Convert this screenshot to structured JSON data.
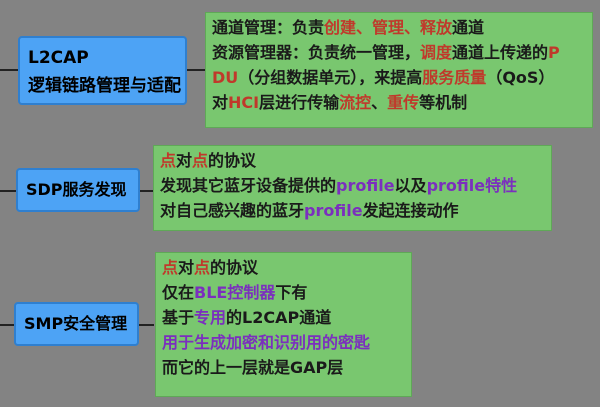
{
  "nodes": {
    "l2cap": {
      "lines": [
        "L2CAP",
        "逻辑链路管理与适配"
      ]
    },
    "sdp": {
      "label": "SDP服务发现"
    },
    "smp": {
      "label": "SMP安全管理"
    }
  },
  "panels": {
    "l2cap": {
      "rows": [
        [
          {
            "t": "通道管理：负责",
            "c": ""
          },
          {
            "t": "创建、管理、释放",
            "c": "r"
          },
          {
            "t": "通道",
            "c": ""
          }
        ],
        [
          {
            "t": "资源管理器：负责统一管理，",
            "c": ""
          },
          {
            "t": "调度",
            "c": "r"
          },
          {
            "t": "通道上传递的",
            "c": ""
          },
          {
            "t": "P",
            "c": "r"
          }
        ],
        [
          {
            "t": "DU",
            "c": "r"
          },
          {
            "t": "（分组数据单元），来提高",
            "c": ""
          },
          {
            "t": "服务质量",
            "c": "r"
          },
          {
            "t": "（QoS）",
            "c": ""
          }
        ],
        [
          {
            "t": "对",
            "c": ""
          },
          {
            "t": "HCI",
            "c": "r"
          },
          {
            "t": "层进行传输",
            "c": ""
          },
          {
            "t": "流控",
            "c": "r"
          },
          {
            "t": "、",
            "c": ""
          },
          {
            "t": "重传",
            "c": "r"
          },
          {
            "t": "等机制",
            "c": ""
          }
        ]
      ]
    },
    "sdp": {
      "rows": [
        [
          {
            "t": "点",
            "c": "r"
          },
          {
            "t": "对",
            "c": ""
          },
          {
            "t": "点",
            "c": "r"
          },
          {
            "t": "的协议",
            "c": ""
          }
        ],
        [
          {
            "t": "发现其它蓝牙设备提供的",
            "c": ""
          },
          {
            "t": "profile",
            "c": "p"
          },
          {
            "t": "以及",
            "c": ""
          },
          {
            "t": "profile特性",
            "c": "p"
          }
        ],
        [
          {
            "t": "对自己感兴趣的蓝牙",
            "c": ""
          },
          {
            "t": "profile",
            "c": "p"
          },
          {
            "t": "发起连接动作",
            "c": ""
          }
        ]
      ]
    },
    "smp": {
      "rows": [
        [
          {
            "t": "点",
            "c": "r"
          },
          {
            "t": "对",
            "c": ""
          },
          {
            "t": "点",
            "c": "r"
          },
          {
            "t": "的协议",
            "c": ""
          }
        ],
        [
          {
            "t": "仅在",
            "c": ""
          },
          {
            "t": "BLE控制器",
            "c": "p"
          },
          {
            "t": "下有",
            "c": ""
          }
        ],
        [
          {
            "t": "基于",
            "c": ""
          },
          {
            "t": "专用",
            "c": "p"
          },
          {
            "t": "的L2CAP通道",
            "c": ""
          }
        ],
        [
          {
            "t": "用于生成加密和识别用的密匙",
            "c": "p"
          }
        ],
        [
          {
            "t": "而它的上一层就是GAP层",
            "c": ""
          }
        ]
      ]
    }
  }
}
